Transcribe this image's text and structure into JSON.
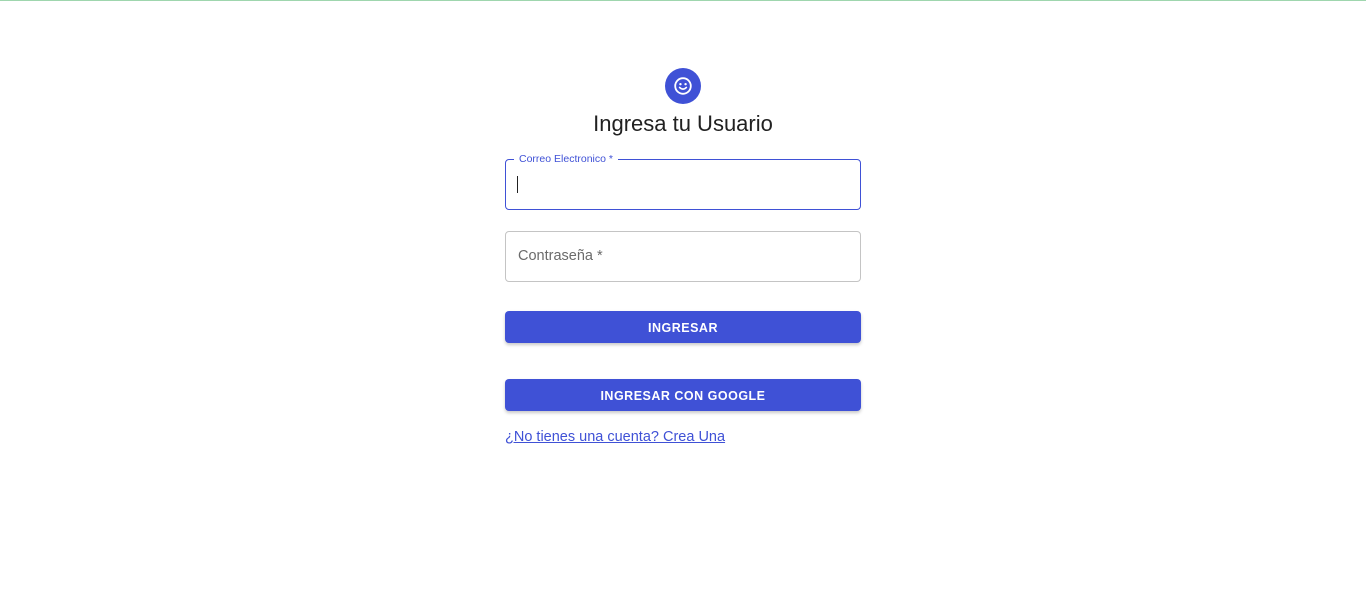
{
  "header": {
    "title": "Ingresa tu Usuario",
    "avatar_icon": "smiley-face-icon"
  },
  "form": {
    "email": {
      "label": "Correo Electronico *",
      "value": "",
      "focused": true
    },
    "password": {
      "label": "Contraseña *",
      "value": ""
    },
    "login_button_label": "INGRESAR",
    "google_button_label": "INGRESAR CON GOOGLE",
    "signup_link_text": "¿No tienes una cuenta? Crea Una"
  },
  "colors": {
    "primary": "#3f51d6",
    "field_border": "#c4c4c4",
    "text": "#212121",
    "top_line": "#9fd6ae"
  }
}
